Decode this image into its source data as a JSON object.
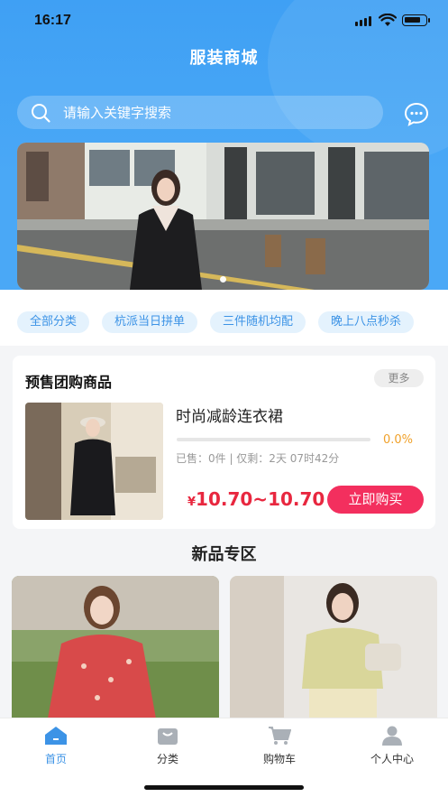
{
  "status": {
    "time": "16:17"
  },
  "header": {
    "title": "服装商城"
  },
  "search": {
    "placeholder": "请输入关键字搜索"
  },
  "banner": {
    "page_count": 1,
    "active_index": 0
  },
  "tags": [
    "全部分类",
    "杭派当日拼单",
    "三件随机均配",
    "晚上八点秒杀"
  ],
  "presale": {
    "title": "预售团购商品",
    "more_label": "更多",
    "product": {
      "name": "时尚减龄连衣裙",
      "progress_percent": 0,
      "progress_label": "0.0%",
      "sold_info": "已售：0件 | 仅剩：2天 07时42分",
      "price_currency": "¥",
      "price": "10.70~10.70",
      "buy_label": "立即购买"
    }
  },
  "new_section": {
    "title": "新品专区"
  },
  "tabbar": {
    "items": [
      {
        "label": "首页",
        "icon": "home-icon",
        "active": true
      },
      {
        "label": "分类",
        "icon": "category-icon",
        "active": false
      },
      {
        "label": "购物车",
        "icon": "cart-icon",
        "active": false
      },
      {
        "label": "个人中心",
        "icon": "profile-icon",
        "active": false
      }
    ]
  },
  "colors": {
    "primary": "#3fa0f4",
    "price": "#e8273f",
    "buy_button": "#f32f5e",
    "progress": "#f39c12"
  }
}
